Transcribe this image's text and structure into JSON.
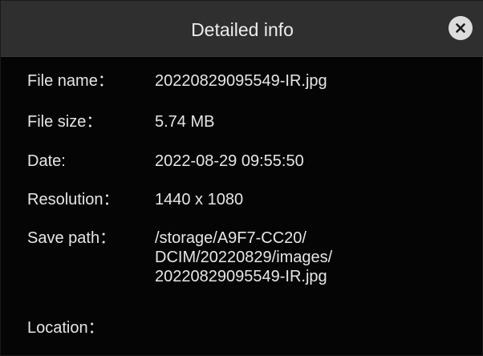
{
  "dialog": {
    "title": "Detailed info",
    "close_icon": "close-icon"
  },
  "fields": {
    "file_name": {
      "label": "File name：",
      "value": "20220829095549-IR.jpg"
    },
    "file_size": {
      "label": "File size：",
      "value": "5.74 MB"
    },
    "date": {
      "label": "Date:",
      "value": "2022-08-29 09:55:50"
    },
    "resolution": {
      "label": "Resolution：",
      "value": "1440 x 1080"
    },
    "save_path": {
      "label": "Save path：",
      "lines": [
        "/storage/A9F7-CC20/",
        "DCIM/20220829/images/",
        "20220829095549-IR.jpg"
      ]
    },
    "location": {
      "label": "Location：",
      "value": ""
    }
  },
  "colors": {
    "header_bg": "#2f2f2f",
    "body_bg": "#050505",
    "text": "#e6e6e6",
    "close_bg": "#dcdcdc"
  }
}
